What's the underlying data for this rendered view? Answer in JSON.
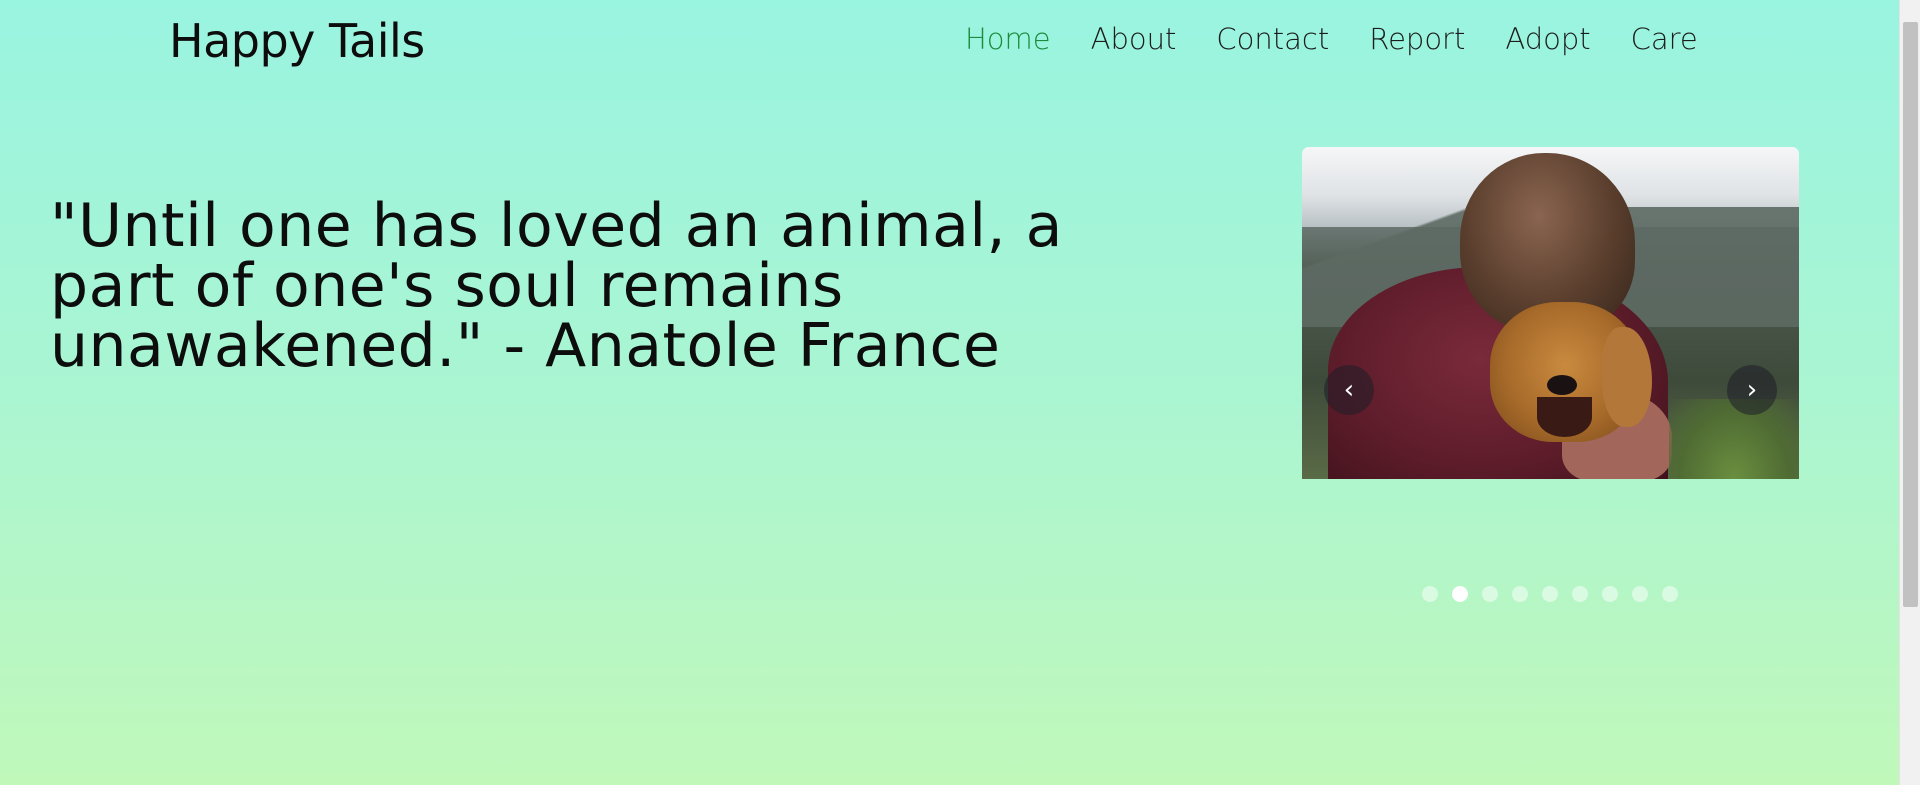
{
  "brand": {
    "name": "Happy Tails"
  },
  "nav": {
    "items": [
      {
        "label": "Home",
        "active": true
      },
      {
        "label": "About",
        "active": false
      },
      {
        "label": "Contact",
        "active": false
      },
      {
        "label": "Report",
        "active": false
      },
      {
        "label": "Adopt",
        "active": false
      },
      {
        "label": "Care",
        "active": false
      }
    ]
  },
  "hero": {
    "quote": "\"Until one has loved an animal, a part of one's soul remains unawakened.\" - Anatole France"
  },
  "carousel": {
    "prev_icon": "chevron-left-icon",
    "next_icon": "chevron-right-icon",
    "prev_glyph": "‹",
    "next_glyph": "›",
    "slide_count": 9,
    "active_index": 1
  },
  "colors": {
    "active_nav": "#1d8a3c",
    "gradient_top": "#99f4e0",
    "gradient_bottom": "#c0f8ba"
  }
}
